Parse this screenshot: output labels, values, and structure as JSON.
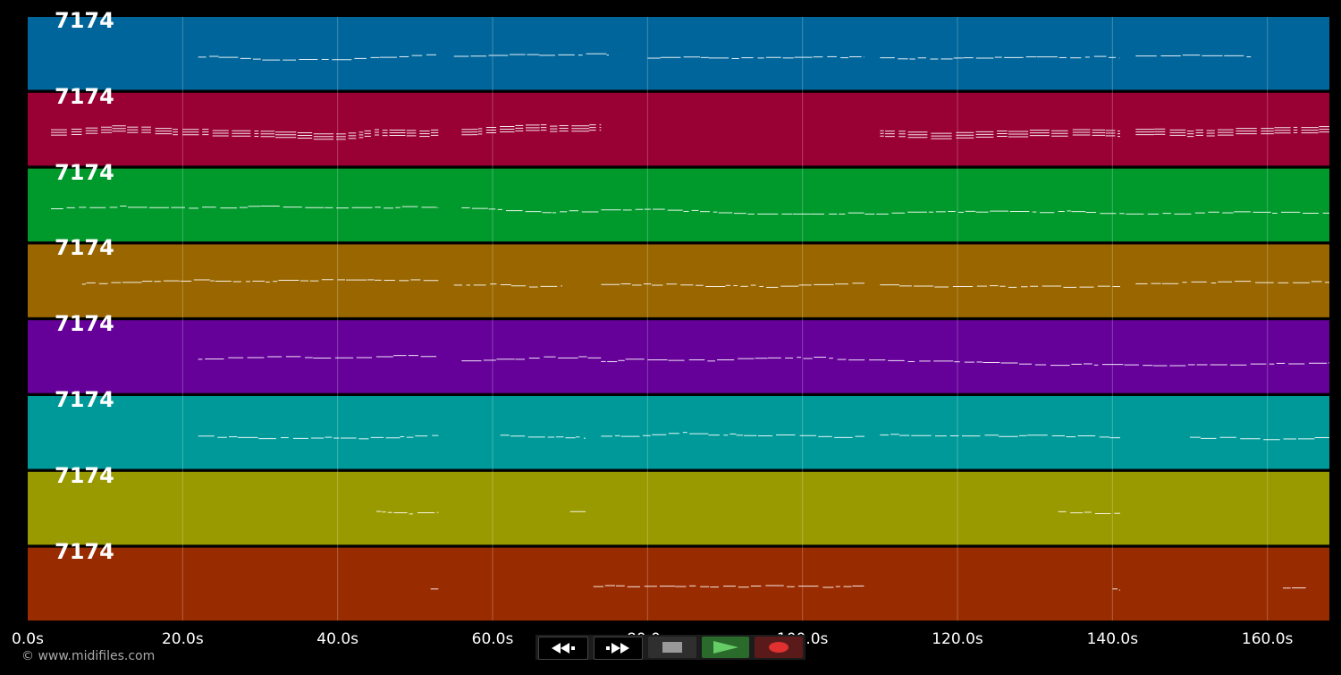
{
  "lanes": [
    {
      "label": "7174",
      "color": "#00659a"
    },
    {
      "label": "7174",
      "color": "#990033"
    },
    {
      "label": "7174",
      "color": "#00992b"
    },
    {
      "label": "7174",
      "color": "#996600"
    },
    {
      "label": "7174",
      "color": "#650099"
    },
    {
      "label": "7174",
      "color": "#009999"
    },
    {
      "label": "7174",
      "color": "#999900"
    },
    {
      "label": "7174",
      "color": "#992b00"
    }
  ],
  "time_axis": {
    "ticks": [
      "0.0s",
      "20.0s",
      "40.0s",
      "60.0s",
      "80.0s",
      "100.0s",
      "120.0s",
      "140.0s",
      "160.0s"
    ],
    "tick_values": [
      0,
      20,
      40,
      60,
      80,
      100,
      120,
      140,
      160
    ],
    "max_seconds": 168
  },
  "copyright": "© www.midifiles.com",
  "transport": {
    "rewind": "rewind-icon",
    "fast_forward": "fast-forward-icon",
    "stop": "stop-icon",
    "play": "play-icon",
    "record": "record-icon",
    "colors": {
      "stop": "#999999",
      "play": "#66cc66",
      "record": "#e03030"
    }
  }
}
